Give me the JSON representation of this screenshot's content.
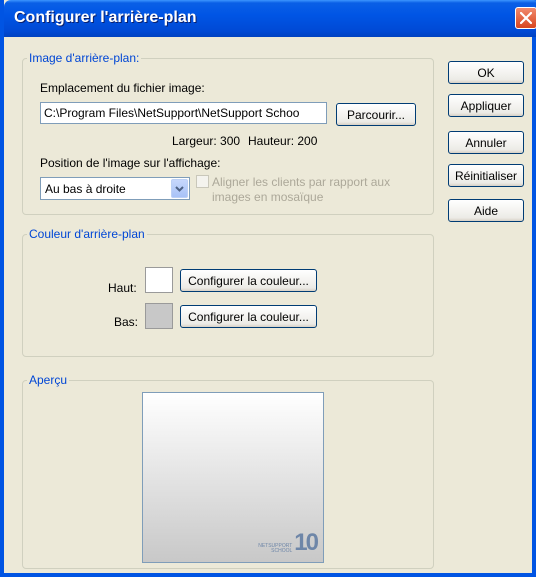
{
  "window": {
    "title": "Configurer l'arrière-plan"
  },
  "image_group": {
    "legend": "Image d'arrière-plan:",
    "location_label": "Emplacement du fichier image:",
    "path_value": "C:\\Program Files\\NetSupport\\NetSupport Schoo",
    "browse_label": "Parcourir...",
    "width_label": "Largeur: 300",
    "height_label": "Hauteur: 200",
    "position_label": "Position de l'image sur l'affichage:",
    "position_value": "Au bas à droite",
    "align_line1": "Aligner les clients par rapport aux",
    "align_line2": "images en mosaïque",
    "align_checked": false
  },
  "color_group": {
    "legend": "Couleur d'arrière-plan",
    "top_label": "Haut:",
    "top_color": "#ffffff",
    "top_button": "Configurer la couleur...",
    "bottom_label": "Bas:",
    "bottom_color": "#c8c8c8",
    "bottom_button": "Configurer la couleur..."
  },
  "preview_group": {
    "legend": "Aperçu",
    "logo_small": "NETSUPPORT SCHOOL",
    "logo_big": "10"
  },
  "side_buttons": {
    "ok": "OK",
    "apply": "Appliquer",
    "cancel": "Annuler",
    "reset": "Réinitialiser",
    "help": "Aide"
  }
}
